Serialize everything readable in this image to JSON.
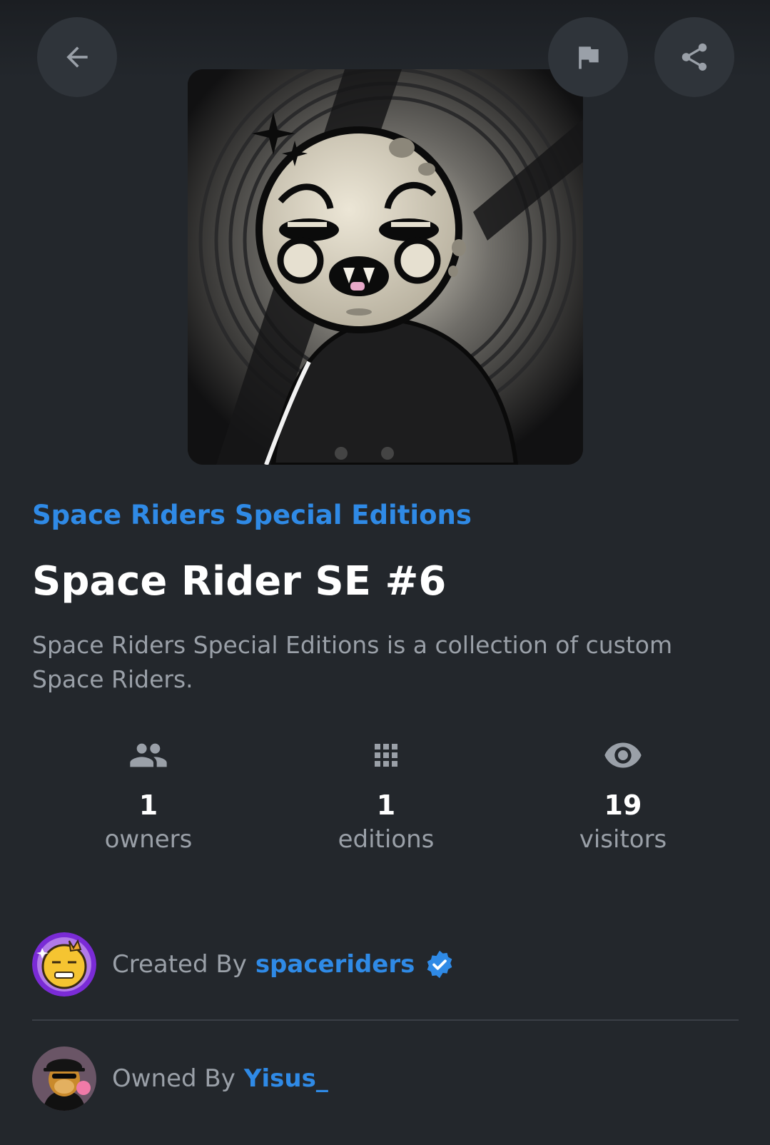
{
  "header": {
    "back_icon": "arrow-left-icon",
    "report_icon": "flag-icon",
    "share_icon": "share-icon"
  },
  "nft": {
    "collection": "Space Riders Special Editions",
    "title": "Space Rider SE #6",
    "description": "Space Riders Special Editions is a collection of custom Space Riders."
  },
  "stats": [
    {
      "icon": "people-icon",
      "value": "1",
      "label": "owners"
    },
    {
      "icon": "grid-icon",
      "value": "1",
      "label": "editions"
    },
    {
      "icon": "eye-icon",
      "value": "19",
      "label": "visitors"
    }
  ],
  "creator": {
    "label": "Created By",
    "name": "spaceriders",
    "verified": true
  },
  "owner": {
    "label": "Owned By",
    "name": "Yisus_"
  },
  "colors": {
    "background": "#23272c",
    "accent": "#2f8ae6",
    "muted_text": "#9aa0a8",
    "button_bg": "#2f343a"
  }
}
